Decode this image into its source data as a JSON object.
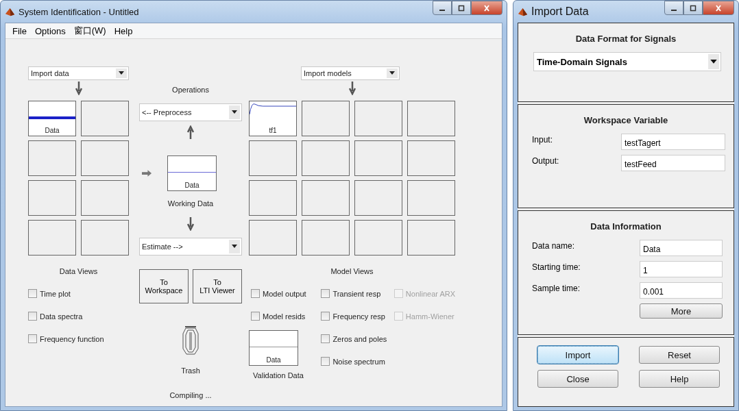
{
  "main_window": {
    "title": "System Identification - Untitled"
  },
  "menu": [
    {
      "label": "File"
    },
    {
      "label": "Options"
    },
    {
      "label": "窗口(W)"
    },
    {
      "label": "Help"
    }
  ],
  "data_board": {
    "dropdown": "Import data",
    "tiles": [
      {
        "kind": "data",
        "label": "Data"
      },
      {
        "kind": "empty"
      },
      {
        "kind": "empty"
      },
      {
        "kind": "empty"
      },
      {
        "kind": "empty"
      },
      {
        "kind": "empty"
      },
      {
        "kind": "empty"
      },
      {
        "kind": "empty"
      }
    ]
  },
  "operations": {
    "title": "Operations",
    "preprocess": "<-- Preprocess",
    "working_data": {
      "label": "Data",
      "caption": "Working Data"
    },
    "estimate": "Estimate -->",
    "buttons": [
      "To\nWorkspace",
      "To\nLTI Viewer"
    ],
    "trash": "Trash",
    "status": "Compiling ..."
  },
  "model_board": {
    "dropdown": "Import models",
    "tiles": [
      {
        "kind": "model",
        "label": "tf1"
      },
      {
        "kind": "empty"
      },
      {
        "kind": "empty"
      },
      {
        "kind": "empty"
      },
      {
        "kind": "empty"
      },
      {
        "kind": "empty"
      },
      {
        "kind": "empty"
      },
      {
        "kind": "empty"
      },
      {
        "kind": "empty"
      },
      {
        "kind": "empty"
      },
      {
        "kind": "empty"
      },
      {
        "kind": "empty"
      },
      {
        "kind": "empty"
      },
      {
        "kind": "empty"
      },
      {
        "kind": "empty"
      },
      {
        "kind": "empty"
      }
    ]
  },
  "data_views": {
    "title": "Data Views",
    "checkboxes": [
      {
        "label": "Time plot",
        "checked": false,
        "disabled": false
      },
      {
        "label": "Data spectra",
        "checked": false,
        "disabled": false
      },
      {
        "label": "Frequency function",
        "checked": false,
        "disabled": false
      }
    ]
  },
  "model_views": {
    "title": "Model Views",
    "columns": [
      [
        {
          "label": "Model output",
          "checked": false,
          "disabled": false
        },
        {
          "label": "Model resids",
          "checked": false,
          "disabled": false
        }
      ],
      [
        {
          "label": "Transient resp",
          "checked": false,
          "disabled": false
        },
        {
          "label": "Frequency resp",
          "checked": false,
          "disabled": false
        },
        {
          "label": "Zeros and poles",
          "checked": false,
          "disabled": false
        },
        {
          "label": "Noise spectrum",
          "checked": false,
          "disabled": false
        }
      ],
      [
        {
          "label": "Nonlinear ARX",
          "checked": false,
          "disabled": true
        },
        {
          "label": "Hamm-Wiener",
          "checked": false,
          "disabled": true
        }
      ]
    ],
    "validation_data": {
      "label": "Data",
      "caption": "Validation Data"
    }
  },
  "import_dialog": {
    "title": "Import Data",
    "format": {
      "title": "Data Format for Signals",
      "value": "Time-Domain Signals"
    },
    "workspace": {
      "title": "Workspace Variable",
      "fields": [
        {
          "label": "Input:",
          "value": "testTagert"
        },
        {
          "label": "Output:",
          "value": "testFeed"
        }
      ]
    },
    "info": {
      "title": "Data Information",
      "fields": [
        {
          "label": "Data name:",
          "value": "Data"
        },
        {
          "label": "Starting time:",
          "value": "1"
        },
        {
          "label": "Sample time:",
          "value": "0.001"
        }
      ],
      "more": "More"
    },
    "buttons": [
      {
        "label": "Import",
        "focused": true
      },
      {
        "label": "Reset",
        "focused": false
      },
      {
        "label": "Close",
        "focused": false
      },
      {
        "label": "Help",
        "focused": false
      }
    ]
  }
}
